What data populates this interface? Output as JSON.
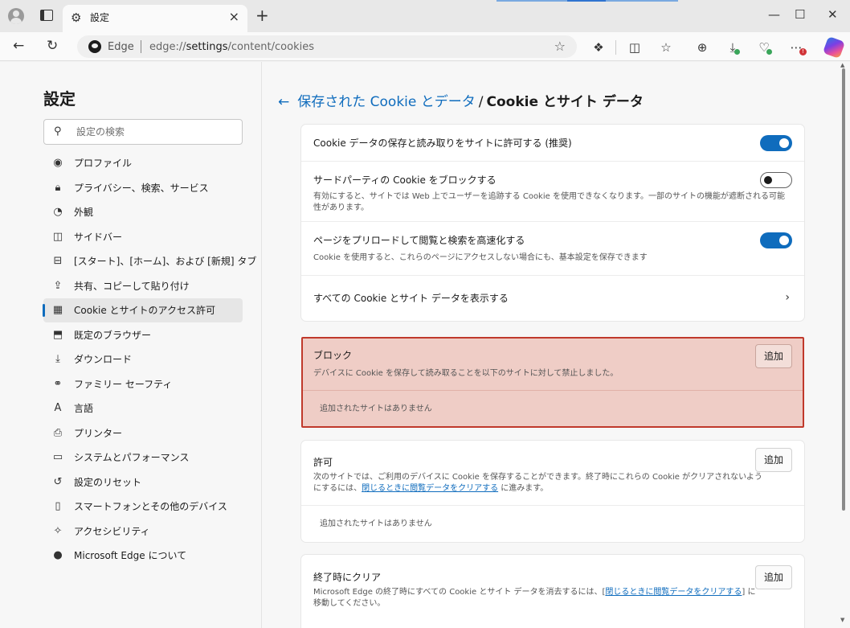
{
  "window": {
    "tab_title": "設定",
    "tab_close": "×",
    "new_tab": "+",
    "controls": {
      "minimize": "—",
      "maximize": "☐",
      "close": "✕"
    }
  },
  "toolbar": {
    "back": "←",
    "refresh": "↻",
    "brand": "Edge",
    "url_prefix": "edge://",
    "url_host": "settings",
    "url_path": "/content/cookies",
    "favorite": "☆"
  },
  "sidebar": {
    "title": "設定",
    "search_placeholder": "設定の検索",
    "items": [
      {
        "label": "プロファイル",
        "icon": "profile-icon",
        "glyph": "◉"
      },
      {
        "label": "プライバシー、検索、サービス",
        "icon": "lock-icon",
        "glyph": "🔒︎"
      },
      {
        "label": "外観",
        "icon": "palette-icon",
        "glyph": "◔"
      },
      {
        "label": "サイドバー",
        "icon": "sidebar-icon",
        "glyph": "◫"
      },
      {
        "label": "[スタート]、[ホーム]、および [新規] タブ",
        "icon": "home-tab-icon",
        "glyph": "⊟"
      },
      {
        "label": "共有、コピーして貼り付け",
        "icon": "share-icon",
        "glyph": "⇪"
      },
      {
        "label": "Cookie とサイトのアクセス許可",
        "icon": "cookie-permissions-icon",
        "glyph": "▦",
        "active": true
      },
      {
        "label": "既定のブラウザー",
        "icon": "default-browser-icon",
        "glyph": "⬒"
      },
      {
        "label": "ダウンロード",
        "icon": "download-icon",
        "glyph": "⤓"
      },
      {
        "label": "ファミリー セーフティ",
        "icon": "family-icon",
        "glyph": "⚭"
      },
      {
        "label": "言語",
        "icon": "language-icon",
        "glyph": "A"
      },
      {
        "label": "プリンター",
        "icon": "printer-icon",
        "glyph": "⎙"
      },
      {
        "label": "システムとパフォーマンス",
        "icon": "laptop-icon",
        "glyph": "▭"
      },
      {
        "label": "設定のリセット",
        "icon": "reset-icon",
        "glyph": "↺"
      },
      {
        "label": "スマートフォンとその他のデバイス",
        "icon": "phone-icon",
        "glyph": "▯"
      },
      {
        "label": "アクセシビリティ",
        "icon": "accessibility-icon",
        "glyph": "✧"
      },
      {
        "label": "Microsoft Edge について",
        "icon": "edge-logo-icon",
        "glyph": "●"
      }
    ]
  },
  "header": {
    "back": "←",
    "parent": "保存された Cookie とデータ",
    "separator": "/",
    "current": "Cookie とサイト データ"
  },
  "settings": {
    "allow_cookies": {
      "title": "Cookie データの保存と読み取りをサイトに許可する (推奨)",
      "on": true
    },
    "block_third_party": {
      "title": "サードパーティの Cookie をブロックする",
      "desc": "有効にすると、サイトでは Web 上でユーザーを追跡する Cookie を使用できなくなります。一部のサイトの機能が遮断される可能性があります。",
      "on": false
    },
    "preload": {
      "title": "ページをプリロードして閲覧と検索を高速化する",
      "desc": "Cookie を使用すると、これらのページにアクセスしない場合にも、基本設定を保存できます",
      "on": true
    },
    "see_all": {
      "title": "すべての Cookie とサイト データを表示する",
      "chevron": "›"
    }
  },
  "block": {
    "title": "ブロック",
    "desc": "デバイスに Cookie を保存して読み取ることを以下のサイトに対して禁止しました。",
    "add": "追加",
    "empty": "追加されたサイトはありません"
  },
  "allow": {
    "title": "許可",
    "desc_before": "次のサイトでは、ご利用のデバイスに Cookie を保存することができます。終了時にこれらの Cookie がクリアされないようにするには、",
    "desc_link": "閉じるときに閲覧データをクリアする",
    "desc_after": " に進みます。",
    "add": "追加",
    "empty": "追加されたサイトはありません"
  },
  "clear_on_exit": {
    "title": "終了時にクリア",
    "desc_before": "Microsoft Edge の終了時にすべての Cookie とサイト データを消去するには、[",
    "desc_link": "閉じるときに閲覧データをクリアする",
    "desc_after": "] に移動してください。",
    "add": "追加"
  }
}
